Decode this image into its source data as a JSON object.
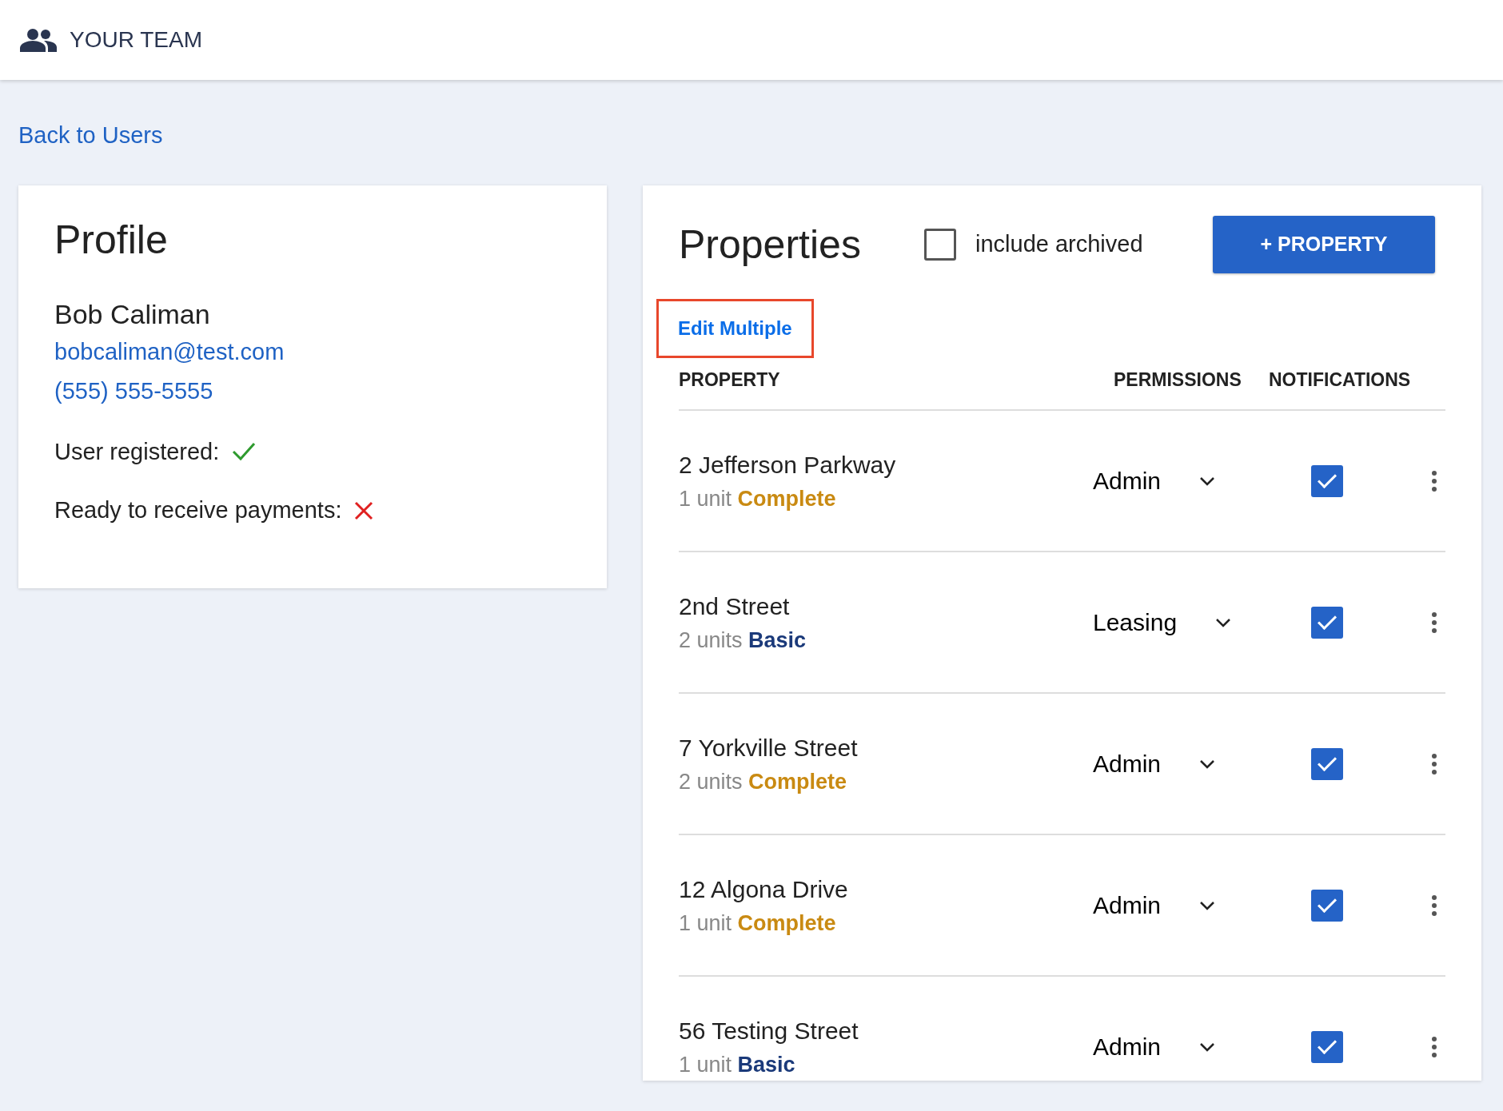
{
  "header": {
    "title": "YOUR TEAM"
  },
  "back_link": "Back to Users",
  "profile": {
    "title": "Profile",
    "name": "Bob Caliman",
    "email": "bobcaliman@test.com",
    "phone": "(555) 555-5555",
    "registered_label": "User registered:",
    "registered": true,
    "payments_label": "Ready to receive payments:",
    "payments_ready": false
  },
  "properties": {
    "title": "Properties",
    "include_archived": {
      "label": "include archived",
      "checked": false
    },
    "add_button": "+ PROPERTY",
    "edit_multiple": "Edit Multiple",
    "columns": [
      "PROPERTY",
      "PERMISSIONS",
      "NOTIFICATIONS"
    ],
    "rows": [
      {
        "name": "2 Jefferson Parkway",
        "units": "1 unit",
        "plan": "Complete",
        "color": "#c98a12",
        "permission": "Admin",
        "notifications": true
      },
      {
        "name": "2nd Street",
        "units": "2 units",
        "plan": "Basic",
        "color": "#1b3a7a",
        "permission": "Leasing",
        "notifications": true
      },
      {
        "name": "7 Yorkville Street",
        "units": "2 units",
        "plan": "Complete",
        "color": "#c98a12",
        "permission": "Admin",
        "notifications": true
      },
      {
        "name": "12 Algona Drive",
        "units": "1 unit",
        "plan": "Complete",
        "color": "#c98a12",
        "permission": "Admin",
        "notifications": true
      },
      {
        "name": "56 Testing Street",
        "units": "1 unit",
        "plan": "Basic",
        "color": "#1b3a7a",
        "permission": "Admin",
        "notifications": true
      }
    ]
  }
}
